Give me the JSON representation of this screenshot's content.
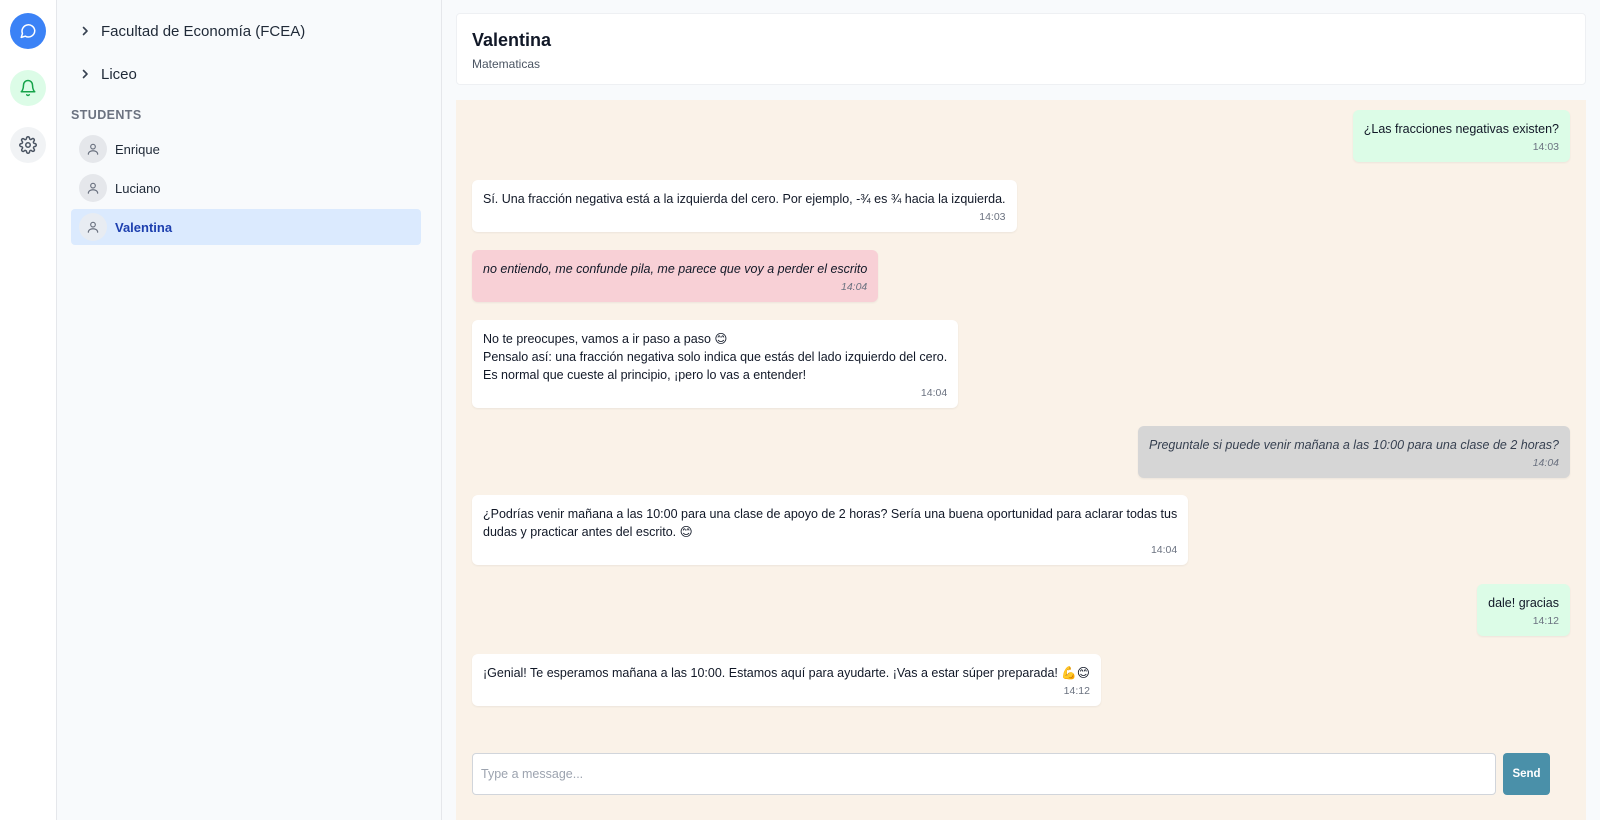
{
  "rail": {
    "items": [
      {
        "icon": "chat-bubble-icon",
        "active": true
      },
      {
        "icon": "bell-icon"
      },
      {
        "icon": "gear-icon"
      }
    ]
  },
  "sidebar": {
    "groups": [
      {
        "label": "Facultad de Economía (FCEA)",
        "icon": "chevron-right-icon"
      },
      {
        "label": "Liceo",
        "icon": "chevron-right-icon"
      }
    ],
    "section_label": "STUDENTS",
    "students": [
      {
        "name": "Enrique",
        "selected": false
      },
      {
        "name": "Luciano",
        "selected": false
      },
      {
        "name": "Valentina",
        "selected": true
      }
    ]
  },
  "chat": {
    "name": "Valentina",
    "subject": "Matematicas",
    "messages": [
      {
        "type": "outgoing",
        "text": "¿Las fracciones negativas existen?",
        "time": "14:03"
      },
      {
        "type": "incoming",
        "text": "Sí. Una fracción negativa está a la izquierda del cero. Por ejemplo, -¾ es ¾ hacia la izquierda.",
        "time": "14:03"
      },
      {
        "type": "flagged",
        "text": "no entiendo, me confunde pila, me parece que voy a perder el escrito",
        "time": "14:04"
      },
      {
        "type": "incoming",
        "lines": [
          "No te preocupes, vamos a ir paso a paso 😊",
          "Pensalo así: una fracción negativa solo indica que estás del lado izquierdo del cero.",
          "Es normal que cueste al principio, ¡pero lo vas a entender!"
        ],
        "time": "14:04"
      },
      {
        "type": "note",
        "text": "Preguntale si puede venir mañana a las 10:00 para una clase de 2 horas?",
        "time": "14:04"
      },
      {
        "type": "incoming",
        "lines": [
          "¿Podrías venir mañana a las 10:00 para una clase de apoyo de 2 horas? Sería una buena oportunidad para aclarar todas tus",
          "dudas y practicar antes del escrito. 😊"
        ],
        "time": "14:04"
      },
      {
        "type": "outgoing",
        "text": "dale! gracias",
        "time": "14:12"
      },
      {
        "type": "incoming",
        "text": "¡Genial! Te esperamos mañana a las 10:00. Estamos aquí para ayudarte. ¡Vas a estar súper preparada! 💪😊",
        "time": "14:12"
      }
    ]
  },
  "composer": {
    "placeholder": "Type a message...",
    "value": "",
    "send_label": "Send"
  },
  "colors": {
    "accent": "#3b82f6",
    "send_button": "#4a90a9",
    "chat_background": "#faf2e8",
    "outgoing_bubble": "#dcfce7",
    "flagged_bubble": "#f8d0d6",
    "note_bubble": "#d6d6d6",
    "selected_student": "#dbeafe"
  }
}
